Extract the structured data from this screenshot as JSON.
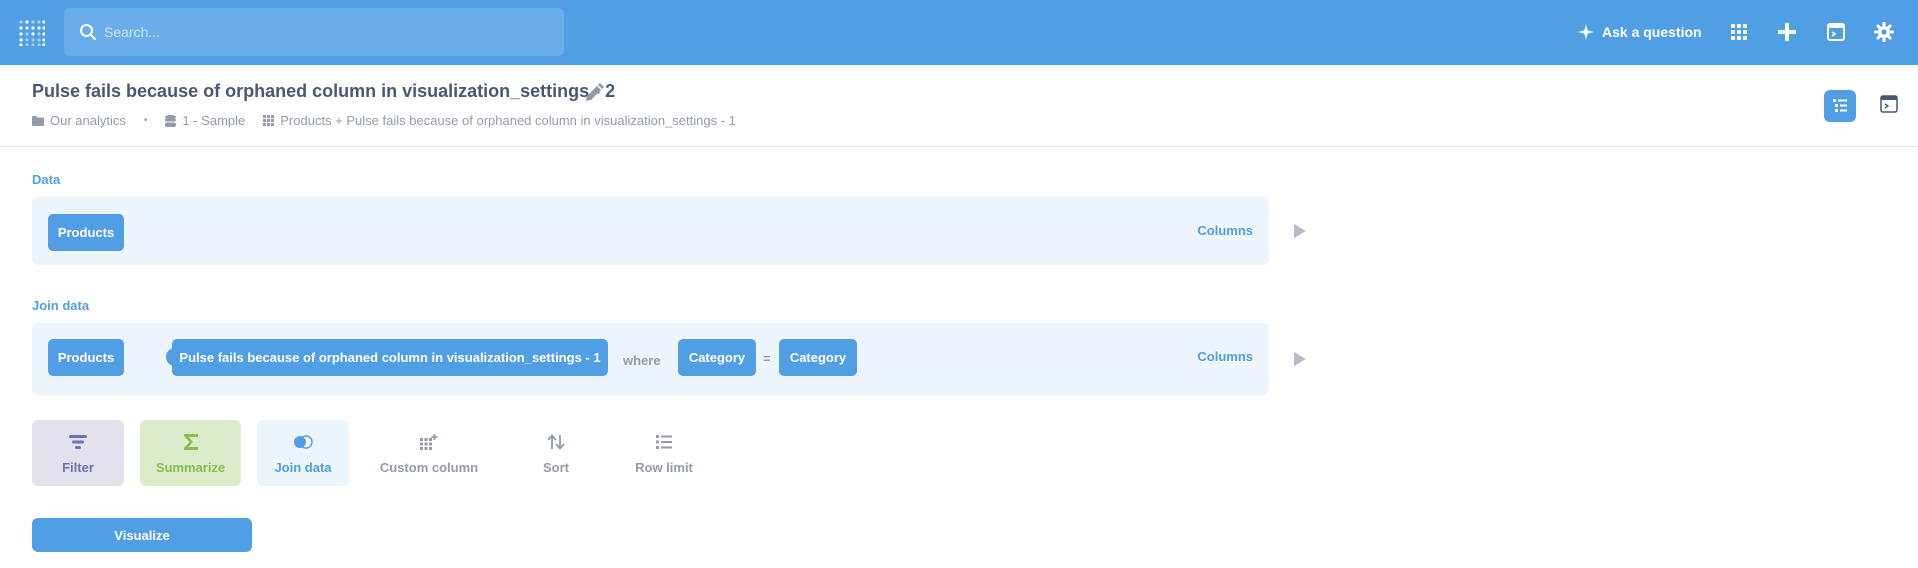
{
  "topnav": {
    "search_placeholder": "Search...",
    "ask_label": "Ask a question",
    "bg_color": "#509ee3"
  },
  "header": {
    "title": "Pulse fails because of orphaned column in visualization_settings - 2",
    "breadcrumbs": {
      "collection": "Our analytics",
      "database": "1 - Sample",
      "table": "Products + Pulse fails because of orphaned column in visualization_settings - 1"
    }
  },
  "notebook": {
    "data_step": {
      "label": "Data",
      "source": "Products",
      "columns_label": "Columns"
    },
    "join_step": {
      "label": "Join data",
      "left_table": "Products",
      "right_table": "Pulse fails because of orphaned column in visualization_settings - 1",
      "where_label": "where",
      "left_column": "Category",
      "operator": "=",
      "right_column": "Category",
      "columns_label": "Columns"
    },
    "actions": {
      "filter": "Filter",
      "summarize": "Summarize",
      "join": "Join data",
      "custom_column": "Custom column",
      "sort": "Sort",
      "row_limit": "Row limit"
    },
    "visualize_label": "Visualize"
  },
  "colors": {
    "brand": "#509ee3",
    "filter": "#7172ad",
    "summarize": "#88bf4d",
    "muted": "#949aab"
  },
  "icons": [
    "metabase-logo-icon",
    "search-icon",
    "sparkle-icon",
    "grid-icon",
    "plus-icon",
    "terminal-icon",
    "gear-icon",
    "pencil-icon",
    "folder-icon",
    "database-icon",
    "table-icon",
    "notebook-icon",
    "sql-icon",
    "play-icon",
    "join-icon",
    "filter-icon",
    "sigma-icon",
    "custom-column-icon",
    "sort-icon",
    "list-icon"
  ]
}
